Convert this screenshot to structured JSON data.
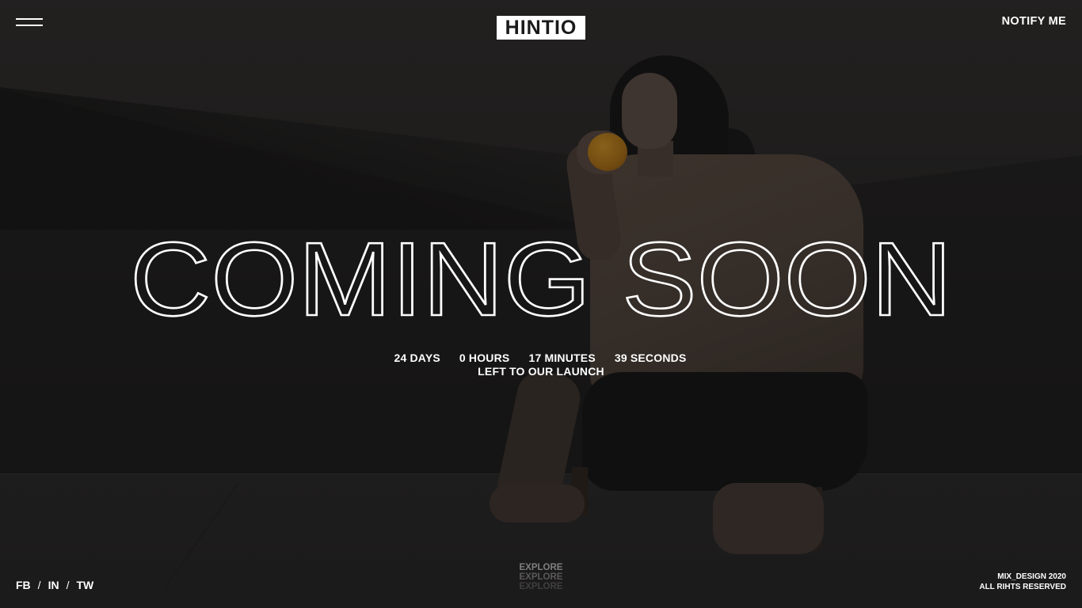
{
  "header": {
    "logo_text": "HINTIO",
    "notify_label": "NOTIFY ME",
    "menu_icon": "hamburger-menu-icon"
  },
  "hero": {
    "headline": "COMING SOON",
    "countdown": [
      {
        "value": "24",
        "unit": "DAYS"
      },
      {
        "value": "0",
        "unit": "HOURS"
      },
      {
        "value": "17",
        "unit": "MINUTES"
      },
      {
        "value": "39",
        "unit": "SECONDS"
      }
    ],
    "countdown_caption": "LEFT TO OUR LAUNCH"
  },
  "footer": {
    "social": [
      "FB",
      "IN",
      "TW"
    ],
    "social_separator": "/",
    "explore_label": "EXPLORE",
    "credits_line1": "MIX_DESIGN 2020",
    "credits_line2": "ALL RIHTS RESERVED"
  },
  "colors": {
    "background": "#1d1b1c",
    "text": "#ffffff",
    "logo_bg": "#ffffff",
    "logo_text": "#1a1a1a"
  }
}
